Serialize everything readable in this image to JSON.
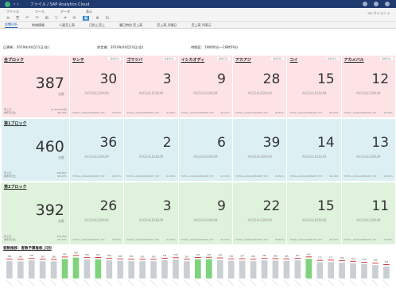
{
  "titlebar": {
    "title": "ファイル / SAP Analytics Cloud",
    "nav": "‹ ›"
  },
  "ribbon": {
    "groups": [
      "ファイル",
      "ツール",
      "データ",
      "表示"
    ],
    "icons": [
      "≡",
      "⎘",
      "↶",
      "↷",
      "⊞",
      "▽",
      "⌗",
      "⟳",
      "▦",
      "⊕",
      "⊡"
    ],
    "right_label": "コレクション  ∨"
  },
  "tabs": [
    "店舗分析",
    "地域情報",
    "人員売上高",
    "日別上売上",
    "曜日時別 売上高",
    "売上高 月曜日",
    "売上高 列表示"
  ],
  "period": {
    "today": "日更新：2019年04月11日(金)",
    "prev": "前営業：2019年04月10日(金)",
    "hours": "時間区：10時00分〜18時59分"
  },
  "blocks": [
    {
      "name": "全ブロック",
      "value": "387",
      "unit": "名数",
      "foot": [
        [
          "売上高",
          "11,414,900円"
        ],
        [
          "前年同日比",
          "98.74%"
        ]
      ],
      "cells": [
        {
          "name": "サンテ",
          "value": "30",
          "badge": "前前日比"
        },
        {
          "name": "ゴマツバ",
          "value": "3",
          "badge": "前前日比"
        },
        {
          "name": "イシカオディ",
          "value": "9",
          "badge": "前前日比"
        },
        {
          "name": "アカアジ",
          "value": "28",
          "badge": "前前日比"
        },
        {
          "name": "コイ",
          "value": "15",
          "badge": "前前日比"
        },
        {
          "name": "アカメバル",
          "value": "12",
          "badge": "前前日比"
        }
      ]
    },
    {
      "name": "第1ブロック",
      "value": "460",
      "unit": "名数",
      "foot": [
        [
          "売上高",
          "299,867"
        ],
        [
          "前年同日比",
          "95.47%"
        ]
      ],
      "cells": [
        {
          "name": "",
          "value": "36",
          "badge": ""
        },
        {
          "name": "",
          "value": "2",
          "badge": ""
        },
        {
          "name": "",
          "value": "6",
          "badge": ""
        },
        {
          "name": "",
          "value": "39",
          "badge": ""
        },
        {
          "name": "",
          "value": "14",
          "badge": ""
        },
        {
          "name": "",
          "value": "13",
          "badge": ""
        }
      ]
    },
    {
      "name": "第2ブロック",
      "value": "392",
      "unit": "名数",
      "foot": [
        [
          "売上高",
          "214,063"
        ],
        [
          "前年同日比",
          "96.32%"
        ]
      ],
      "cells": [
        {
          "name": "",
          "value": "26",
          "badge": ""
        },
        {
          "name": "",
          "value": "3",
          "badge": ""
        },
        {
          "name": "",
          "value": "9",
          "badge": ""
        },
        {
          "name": "",
          "value": "22",
          "badge": ""
        },
        {
          "name": "",
          "value": "15",
          "badge": ""
        },
        {
          "name": "",
          "value": "11",
          "badge": ""
        }
      ]
    }
  ],
  "cell_measure": "AVGSALESNUM",
  "cell_foot_label": "TOTAL_AVGSALESNUM_YOY",
  "cell_foot_values": [
    "95.55%",
    "94.86%",
    "95.93%",
    "98.82%",
    "96.00%",
    "95.06%"
  ],
  "bars": {
    "title": "客数推移：客数予算推移_日別",
    "chart_data": {
      "type": "bar",
      "values": [
        382,
        380,
        390,
        381,
        380,
        405,
        420,
        399,
        400,
        390,
        385,
        382,
        381,
        380,
        392,
        398,
        381,
        400,
        402,
        395,
        385,
        387,
        382,
        390,
        388,
        385,
        391,
        406,
        370,
        372,
        366,
        360,
        350,
        340,
        325
      ],
      "ylim": [
        200,
        450
      ]
    }
  },
  "colors": {
    "pink": "#fde3e6",
    "blue": "#dcf0f4",
    "green": "#dff2dc",
    "bar": "#c9cfd2",
    "accent": "#7ed37c",
    "marker": "#d23c3c"
  }
}
